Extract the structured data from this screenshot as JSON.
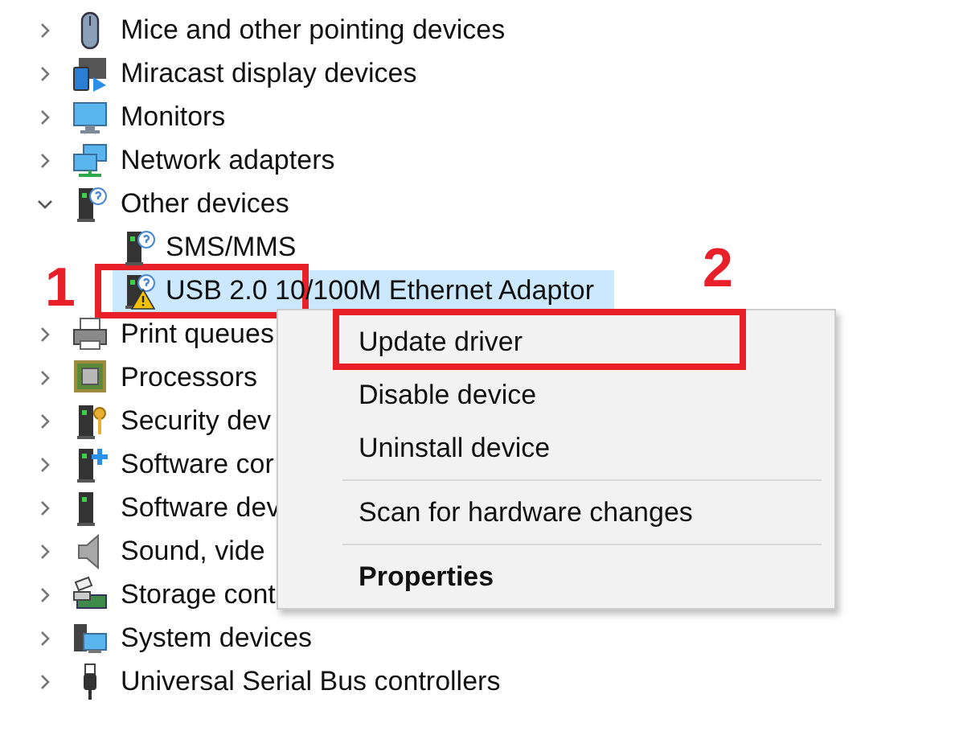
{
  "tree": [
    {
      "label": "Mice and other pointing devices",
      "expanded": false,
      "selected": false
    },
    {
      "label": "Miracast display devices",
      "expanded": false,
      "selected": false
    },
    {
      "label": "Monitors",
      "expanded": false,
      "selected": false
    },
    {
      "label": "Network adapters",
      "expanded": false,
      "selected": false
    },
    {
      "label": "Other devices",
      "expanded": true,
      "selected": false,
      "children": [
        {
          "label": "SMS/MMS",
          "selected": false,
          "warning": false
        },
        {
          "label": "USB 2.0 10/100M Ethernet Adaptor",
          "selected": true,
          "warning": true
        }
      ]
    },
    {
      "label": "Print queues",
      "expanded": false,
      "selected": false
    },
    {
      "label": "Processors",
      "expanded": false,
      "selected": false
    },
    {
      "label": "Security dev",
      "expanded": false,
      "selected": false
    },
    {
      "label": "Software cor",
      "expanded": false,
      "selected": false
    },
    {
      "label": "Software dev",
      "expanded": false,
      "selected": false
    },
    {
      "label": "Sound, vide",
      "expanded": false,
      "selected": false
    },
    {
      "label": "Storage cont",
      "expanded": false,
      "selected": false
    },
    {
      "label": "System devices",
      "expanded": false,
      "selected": false
    },
    {
      "label": "Universal Serial Bus controllers",
      "expanded": false,
      "selected": false
    }
  ],
  "context_menu": [
    {
      "label": "Update driver",
      "default": false,
      "separator_before": false
    },
    {
      "label": "Disable device",
      "default": false,
      "separator_before": false
    },
    {
      "label": "Uninstall device",
      "default": false,
      "separator_before": false
    },
    {
      "label": "Scan for hardware changes",
      "default": false,
      "separator_before": true
    },
    {
      "label": "Properties",
      "default": true,
      "separator_before": true
    }
  ],
  "annotations": [
    {
      "number": "1"
    },
    {
      "number": "2"
    }
  ]
}
